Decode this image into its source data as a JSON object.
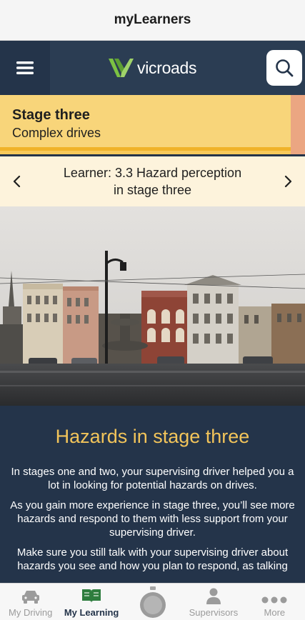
{
  "app": {
    "title": "myLearners"
  },
  "header": {
    "logo_text": "vicroads",
    "brand_green": "#7cc243"
  },
  "stage": {
    "title": "Stage three",
    "subtitle": "Complex drives"
  },
  "learner": {
    "line1": "Learner: 3.3 Hazard perception",
    "line2": "in stage three"
  },
  "article": {
    "heading": "Hazards in stage three",
    "paragraphs": [
      "In stages one and two, your supervising driver helped you a lot in looking for potential hazards on drives.",
      "As you gain more experience in stage three, you’ll see more hazards and respond to them with less support from your supervising driver.",
      "Make sure you still talk with your supervising driver about hazards you see and how you plan to respond, as talking"
    ]
  },
  "tabs": [
    {
      "label": "My Driving",
      "icon": "car-icon",
      "active": false
    },
    {
      "label": "My Learning",
      "icon": "open-book-icon",
      "active": true
    },
    {
      "label": "",
      "icon": "stopwatch-icon",
      "active": false
    },
    {
      "label": "Supervisors",
      "icon": "person-icon",
      "active": false
    },
    {
      "label": "More",
      "icon": "more-dots-icon",
      "active": false
    }
  ]
}
